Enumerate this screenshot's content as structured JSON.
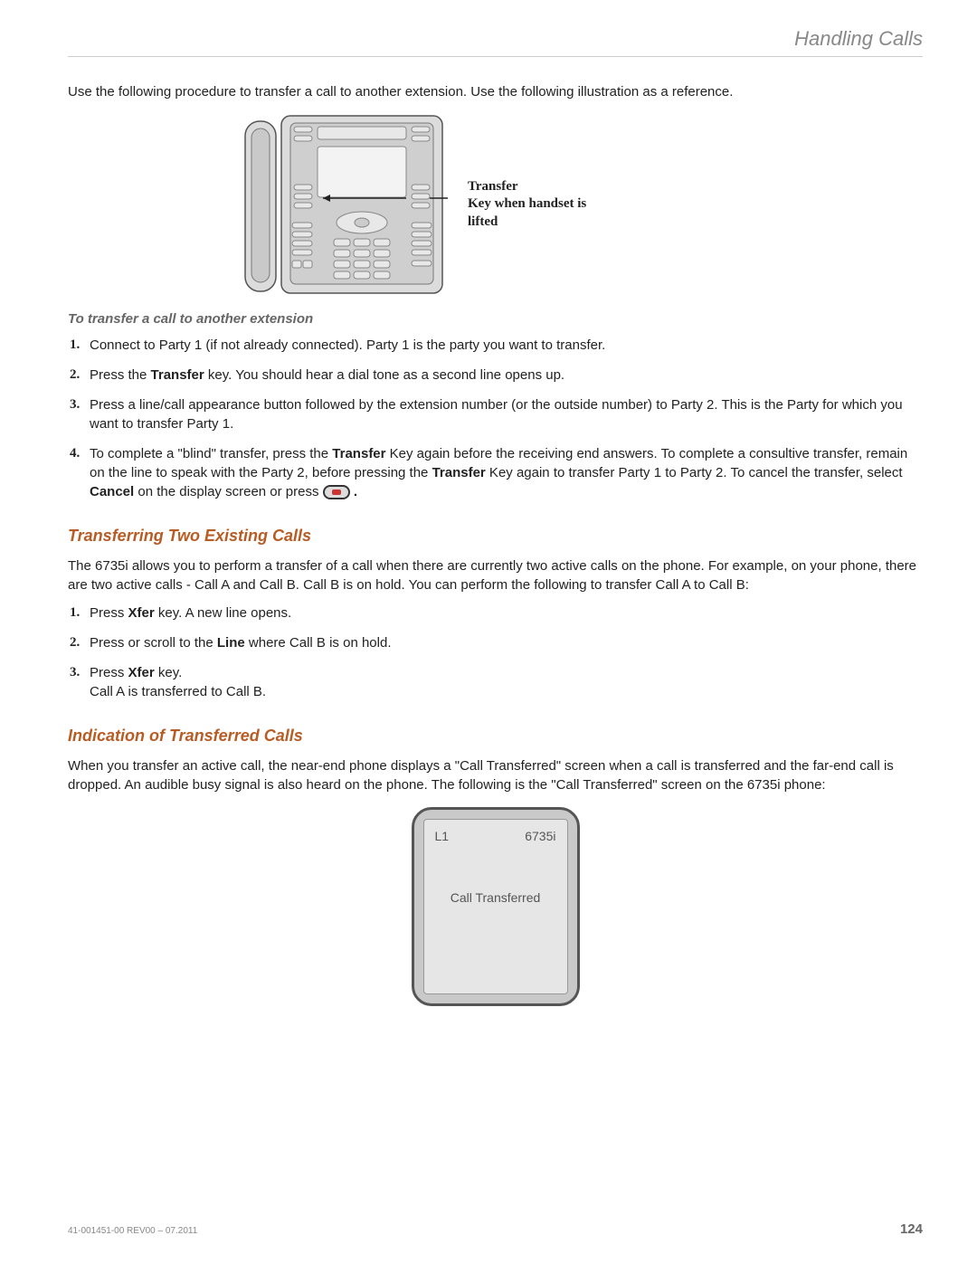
{
  "header": {
    "title": "Handling Calls"
  },
  "intro": "Use the following procedure to transfer a call to another extension. Use the following illustration as a reference.",
  "figure": {
    "callout": "Transfer\nKey when handset is lifted"
  },
  "section1": {
    "heading": "To transfer a call to another extension",
    "steps": {
      "s1": "Connect to Party 1 (if not already connected). Party 1 is the party you want to transfer.",
      "s2_a": "Press the ",
      "s2_b": "Transfer",
      "s2_c": " key. You should hear a dial tone as a second line opens up.",
      "s3": "Press a line/call appearance button followed by the extension number (or the outside number) to Party 2. This is the Party for which you want to transfer Party 1.",
      "s4_a": "To complete a \"blind\" transfer, press the ",
      "s4_b": "Transfer",
      "s4_c": " Key again before the receiving end answers. To complete a consultive transfer, remain on the line to speak with the Party 2, before pressing the ",
      "s4_d": "Transfer",
      "s4_e": " Key again to transfer Party 1 to Party 2. To cancel the transfer, select ",
      "s4_f": "Cancel",
      "s4_g": " on the display screen or press ",
      "s4_h": "."
    }
  },
  "section2": {
    "heading": "Transferring Two Existing Calls",
    "para": "The 6735i allows you to perform a transfer of a call when there are currently two active calls on the phone. For example, on your phone, there are two active calls - Call A and Call B. Call B is on hold. You can perform the following to transfer Call A to Call B:",
    "steps": {
      "s1_a": "Press ",
      "s1_b": "Xfer",
      "s1_c": " key. A new line opens.",
      "s2_a": "Press or scroll to the ",
      "s2_b": "Line",
      "s2_c": " where Call B is on hold.",
      "s3_a": "Press ",
      "s3_b": "Xfer",
      "s3_c": " key.",
      "s3_d": "Call A is transferred to Call B."
    }
  },
  "section3": {
    "heading": "Indication of Transferred Calls",
    "para": "When you transfer an active call, the near-end phone displays a \"Call Transferred\" screen when a call is transferred and the far-end call is dropped. An audible busy signal is also heard on the phone. The following is the \"Call Transferred\" screen on the 6735i phone:",
    "screen": {
      "line": "L1",
      "model": "6735i",
      "message": "Call Transferred"
    }
  },
  "footer": {
    "docid": "41-001451-00 REV00 – 07.2011",
    "page": "124"
  }
}
